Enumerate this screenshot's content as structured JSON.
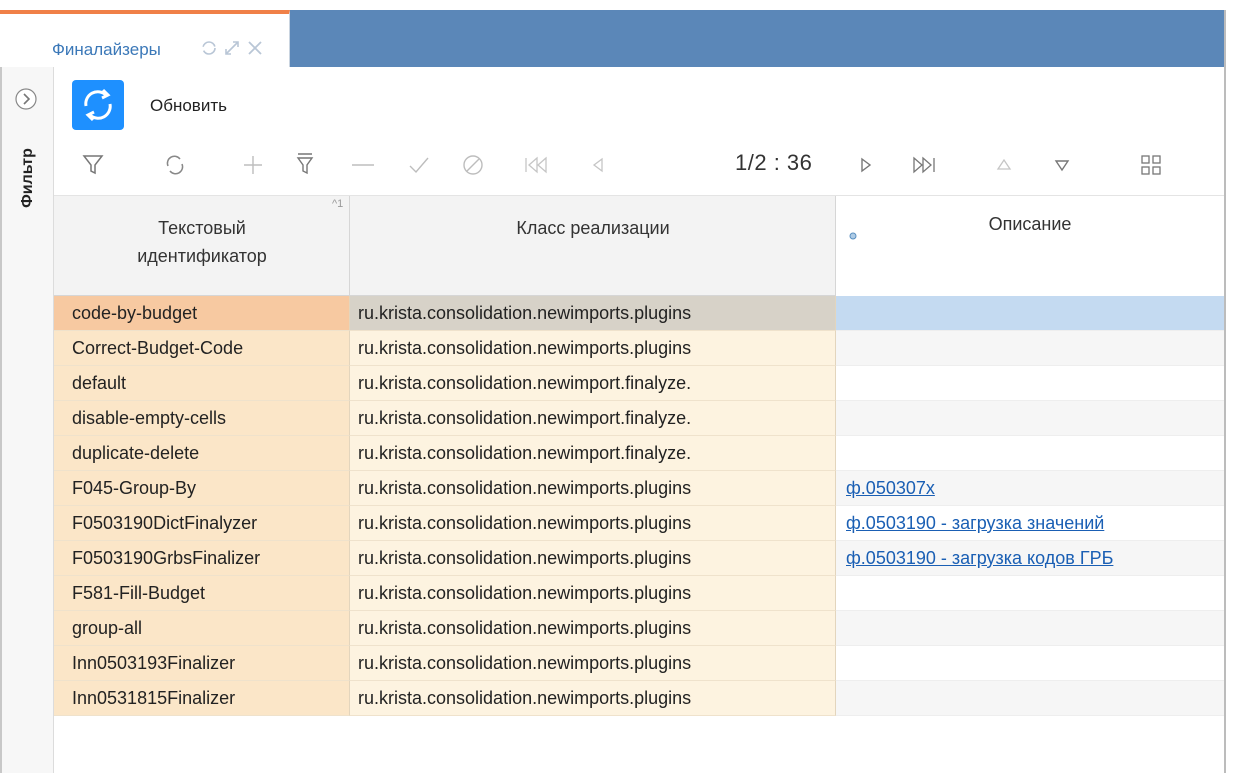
{
  "tab": {
    "title": "Финалайзеры"
  },
  "filter_panel": {
    "label": "Фильтр"
  },
  "toolbar": {
    "refresh_label": "Обновить",
    "pager": "1/2 : 36"
  },
  "grid": {
    "columns": [
      {
        "label_line1": "Текстовый",
        "label_line2": "идентификатор",
        "sort_marker": "^1"
      },
      {
        "label": "Класс реализации"
      },
      {
        "label": "Описание"
      }
    ],
    "rows": [
      {
        "id": "code-by-budget",
        "class": "ru.krista.consolidation.newimports.plugins",
        "description": ""
      },
      {
        "id": "Correct-Budget-Code",
        "class": "ru.krista.consolidation.newimports.plugins",
        "description": ""
      },
      {
        "id": "default",
        "class": "ru.krista.consolidation.newimport.finalyze.",
        "description": ""
      },
      {
        "id": "disable-empty-cells",
        "class": "ru.krista.consolidation.newimport.finalyze.",
        "description": ""
      },
      {
        "id": "duplicate-delete",
        "class": "ru.krista.consolidation.newimport.finalyze.",
        "description": ""
      },
      {
        "id": "F045-Group-By",
        "class": "ru.krista.consolidation.newimports.plugins",
        "description": "ф.050307х"
      },
      {
        "id": "F0503190DictFinalyzer",
        "class": "ru.krista.consolidation.newimports.plugins",
        "description": "ф.0503190 - загрузка значений"
      },
      {
        "id": "F0503190GrbsFinalizer",
        "class": "ru.krista.consolidation.newimports.plugins",
        "description": "ф.0503190 - загрузка кодов ГРБ"
      },
      {
        "id": "F581-Fill-Budget",
        "class": "ru.krista.consolidation.newimports.plugins",
        "description": ""
      },
      {
        "id": "group-all",
        "class": "ru.krista.consolidation.newimports.plugins",
        "description": ""
      },
      {
        "id": "Inn0503193Finalizer",
        "class": "ru.krista.consolidation.newimports.plugins",
        "description": ""
      },
      {
        "id": "Inn0531815Finalizer",
        "class": "ru.krista.consolidation.newimports.plugins",
        "description": ""
      }
    ]
  },
  "icons": [
    "refresh-icon",
    "filter-icon",
    "reload-icon",
    "add-icon",
    "filter-clear-icon",
    "remove-icon",
    "check-icon",
    "cancel-icon",
    "first-page-icon",
    "prev-page-icon",
    "next-page-icon",
    "last-page-icon",
    "sort-up-icon",
    "sort-down-icon",
    "columns-icon",
    "expand-icon",
    "maximize-icon",
    "close-icon"
  ],
  "colors": {
    "tabbar": "#5b87b8",
    "tab_accent": "#f08048",
    "refresh_button": "#1e90ff",
    "key_column": "#fbe6c8",
    "selected_row": "#c4daf1",
    "link": "#1a5fb4"
  }
}
